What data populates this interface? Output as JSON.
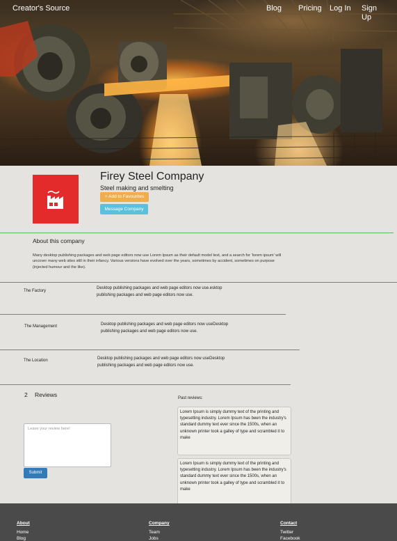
{
  "header": {
    "brand": "Creator's Source",
    "nav": [
      {
        "label": "Blog"
      },
      {
        "label": "Pricing"
      },
      {
        "label": "Log In"
      },
      {
        "label": "Sign Up"
      }
    ]
  },
  "hero": {
    "icon": "steel-mill-photo"
  },
  "company": {
    "name": "Firey Steel Company",
    "tagline": "Steel making and smelting",
    "logo_icon": "factory-icon",
    "logo_color": "#e32b2b",
    "add_favourites_label": "+ Add to Favourites",
    "message_label": "Message Company"
  },
  "about": {
    "title": "About this company",
    "text": "Many desktop publishing packages and web page editors now use Lorem Ipsum as their default model text, and a search for 'lorem ipsum' will uncover many web sites still in their infancy. Various versions have evolved over the years, sometimes by accident, sometimes on purpose (injected humour and the like)."
  },
  "info_rows": [
    {
      "label": "The Factory",
      "text": "Desktop publishing packages and web page editors now use.esktop publishing packages and web page editors now use."
    },
    {
      "label": "The Management",
      "text": "Desktop publishing packages and web page editors now useDesktop publishing packages and web page editors now use."
    },
    {
      "label": "The Location",
      "text": "Desktop publishing packages and web page editors now useDesktop publishing packages and web page editors now use."
    }
  ],
  "reviews": {
    "count": "2",
    "title": "Reviews",
    "placeholder": "Leave your review here!",
    "submit_label": "Submit",
    "past_label": "Past reviews:",
    "items": [
      {
        "text": "Lorem Ipsum is simply dummy text of the printing and typesetting industry. Lorem Ipsum has been the industry's standard dummy text ever since the 1500s, when an unknown printer took a galley of type and scrambled it to make"
      },
      {
        "text": "Lorem Ipsum is simply dummy text of the printing and typesetting industry. Lorem Ipsum has been the industry's standard dummy text ever since the 1500s, when an unknown printer took a galley of type and scrambled it to make"
      }
    ]
  },
  "footer": {
    "columns": [
      {
        "heading": "About",
        "links": [
          "Home",
          "Blog"
        ]
      },
      {
        "heading": "Company",
        "links": [
          "Team",
          "Jobs"
        ]
      },
      {
        "heading": "Contact",
        "links": [
          "Twitter",
          "Facebook"
        ]
      }
    ]
  },
  "colors": {
    "accent_orange": "#f0ad4e",
    "accent_cyan": "#5bc0de",
    "primary_blue": "#337ab7",
    "divider_green": "#5cb85c",
    "footer_bg": "#4a4a4a"
  }
}
